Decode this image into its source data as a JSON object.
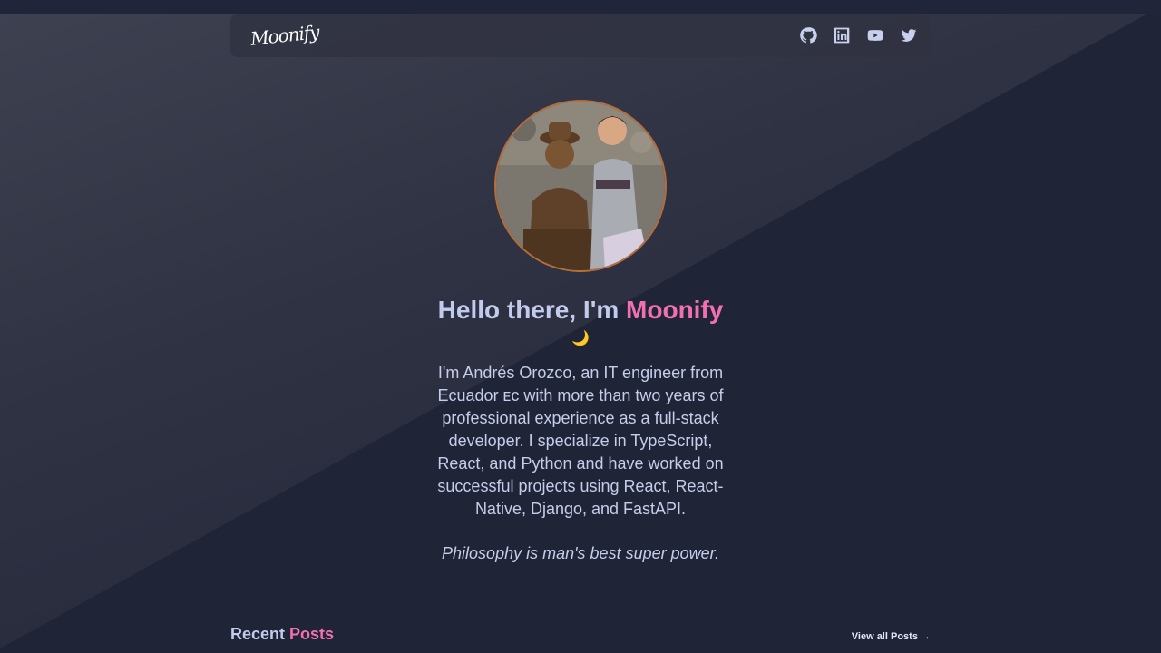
{
  "header": {
    "logo": "Moonify",
    "social": [
      {
        "name": "github-icon"
      },
      {
        "name": "linkedin-icon"
      },
      {
        "name": "youtube-icon"
      },
      {
        "name": "twitter-icon"
      }
    ]
  },
  "hero": {
    "title_prefix": "Hello there, I'm ",
    "title_name": "Moonify",
    "moon": "🌙",
    "bio": "I'm Andrés Orozco, an IT engineer from Ecuador ᴇᴄ with more than two years of professional experience as a full-stack developer. I specialize in TypeScript, React, and Python and have worked on successful projects using React, React-Native, Django, and FastAPI.",
    "quote": "Philosophy is man's best super power."
  },
  "posts": {
    "title_prefix": "Recent ",
    "title_accent": "Posts",
    "view_all": "View all Posts →"
  },
  "colors": {
    "accent": "#f070b2",
    "background": "#20253a",
    "text": "#c5cdea"
  }
}
